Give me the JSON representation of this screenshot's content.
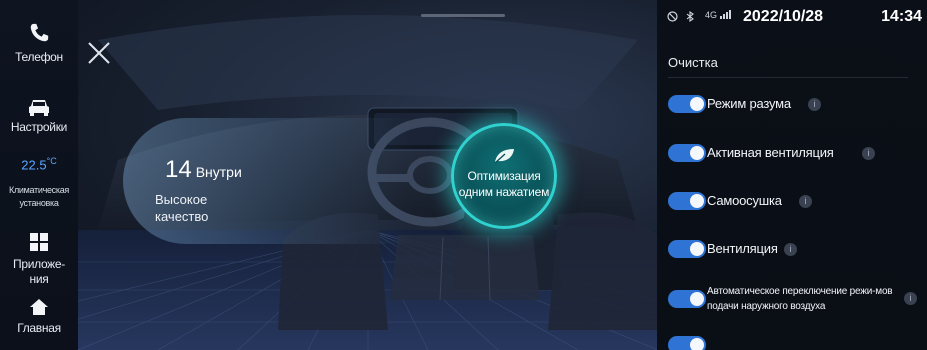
{
  "sidebar": {
    "phone_label": "Телефон",
    "settings_label": "Настройки",
    "climate_temp": "22.5",
    "climate_unit": "°C",
    "climate_label_line1": "Климатическая",
    "climate_label_line2": "установка",
    "apps_label_line1": "Приложе-",
    "apps_label_line2": "ния",
    "home_label": "Главная"
  },
  "main": {
    "aqi_value": "14",
    "aqi_unit": "Внутри",
    "quality_line1": "Высокое",
    "quality_line2": "качество",
    "optimize_line1": "Оптимизация",
    "optimize_line2": "одним нажатием"
  },
  "status_bar": {
    "signal": "4G",
    "date": "2022/10/28",
    "time": "14:34"
  },
  "panel": {
    "title": "Очистка",
    "options": [
      {
        "label": "Режим разума",
        "enabled": true
      },
      {
        "label": "Активная вентиляция",
        "enabled": true
      },
      {
        "label": "Самоосушка",
        "enabled": true
      },
      {
        "label": "Вентиляция",
        "enabled": true
      },
      {
        "label": "Автоматическое переключение режи-мов подачи наружного воздуха",
        "enabled": true
      }
    ],
    "info_glyph": "i"
  },
  "colors": {
    "accent": "#2f74d4",
    "glow": "#2fd2cf",
    "temp": "#5aa7ff"
  }
}
